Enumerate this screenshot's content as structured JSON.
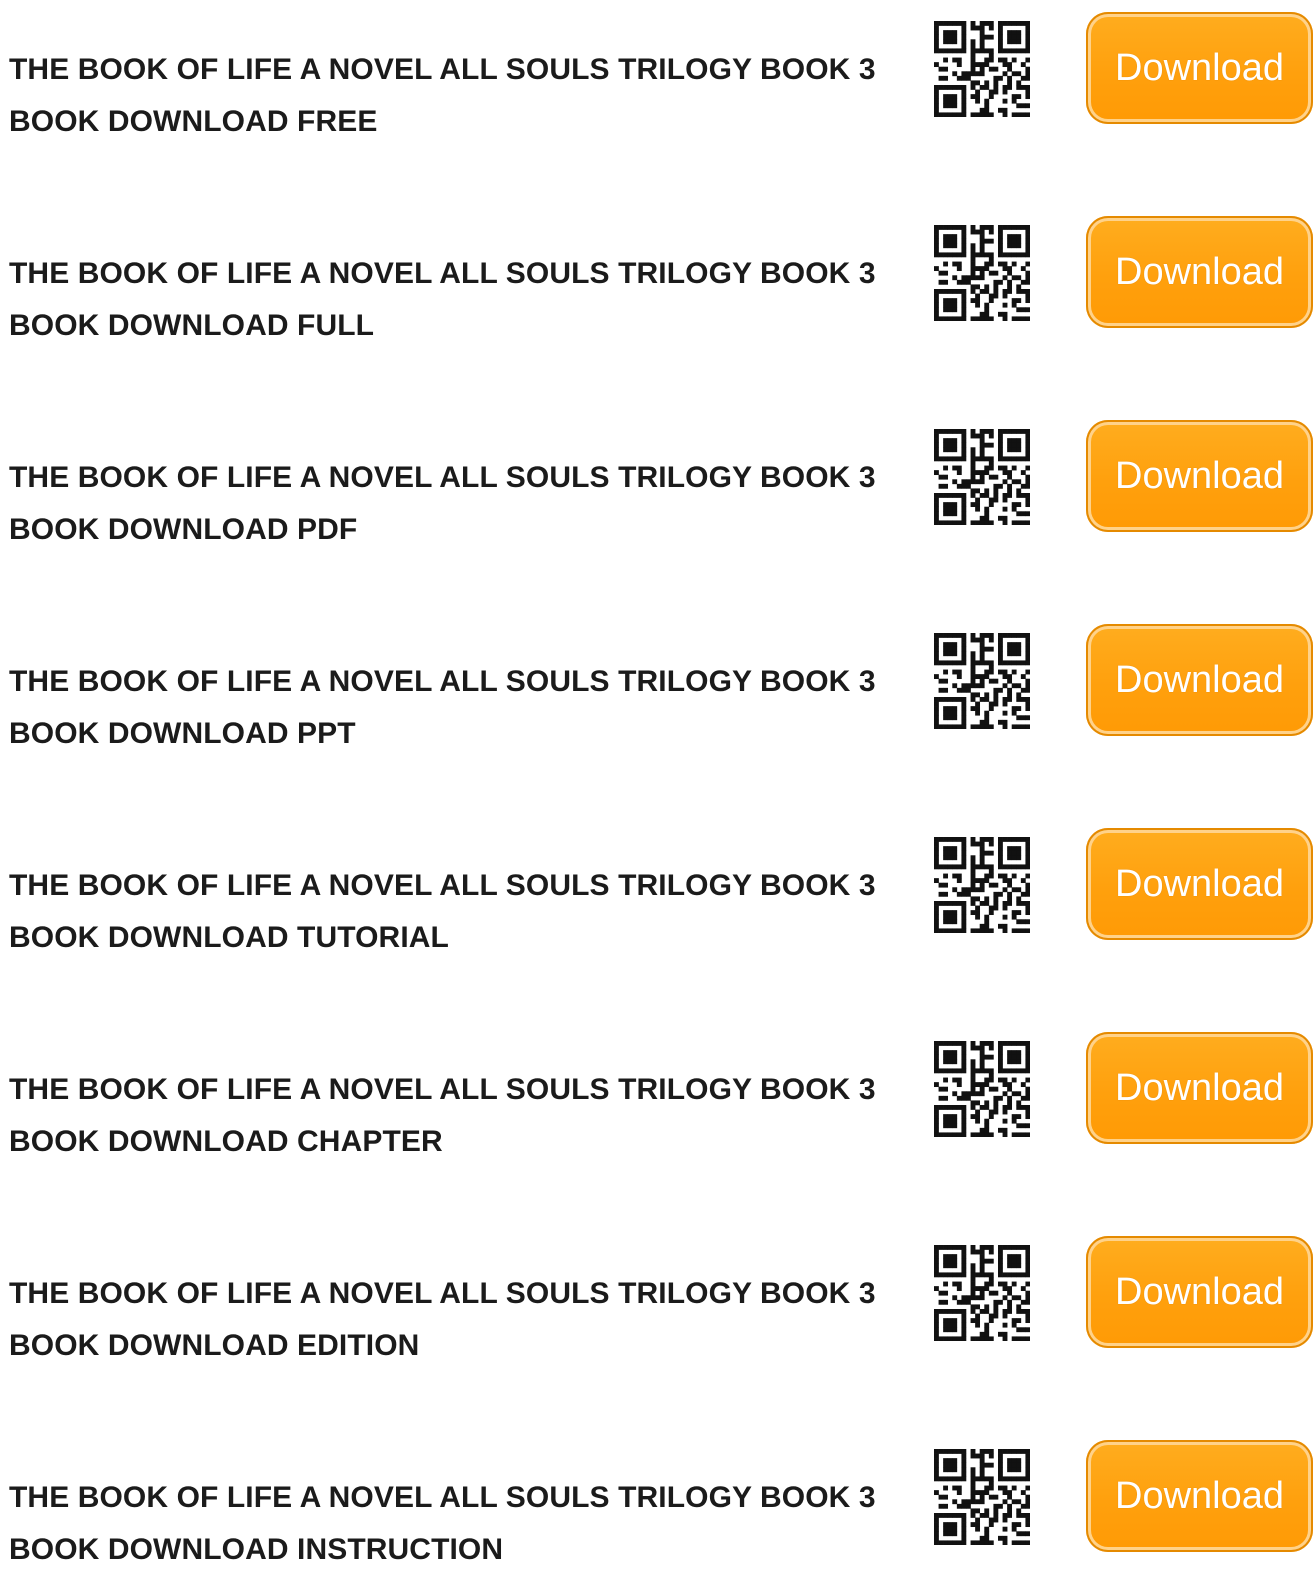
{
  "entries": [
    {
      "title": "THE BOOK OF LIFE A NOVEL ALL SOULS TRILOGY BOOK 3 BOOK DOWNLOAD FREE",
      "button": "Download"
    },
    {
      "title": "THE BOOK OF LIFE A NOVEL ALL SOULS TRILOGY BOOK 3 BOOK DOWNLOAD FULL",
      "button": "Download"
    },
    {
      "title": "THE BOOK OF LIFE A NOVEL ALL SOULS TRILOGY BOOK 3 BOOK DOWNLOAD PDF",
      "button": "Download"
    },
    {
      "title": "THE BOOK OF LIFE A NOVEL ALL SOULS TRILOGY BOOK 3 BOOK DOWNLOAD PPT",
      "button": "Download"
    },
    {
      "title": "THE BOOK OF LIFE A NOVEL ALL SOULS TRILOGY BOOK 3 BOOK DOWNLOAD TUTORIAL",
      "button": "Download"
    },
    {
      "title": "THE BOOK OF LIFE A NOVEL ALL SOULS TRILOGY BOOK 3 BOOK DOWNLOAD CHAPTER",
      "button": "Download"
    },
    {
      "title": "THE BOOK OF LIFE A NOVEL ALL SOULS TRILOGY BOOK 3 BOOK DOWNLOAD EDITION",
      "button": "Download"
    },
    {
      "title": "THE BOOK OF LIFE A NOVEL ALL SOULS TRILOGY BOOK 3 BOOK DOWNLOAD INSTRUCTION",
      "button": "Download"
    }
  ],
  "icons": {
    "qr": "qr-code-icon"
  },
  "colors": {
    "button": "#ffa00d",
    "text": "#1b1b1b"
  }
}
